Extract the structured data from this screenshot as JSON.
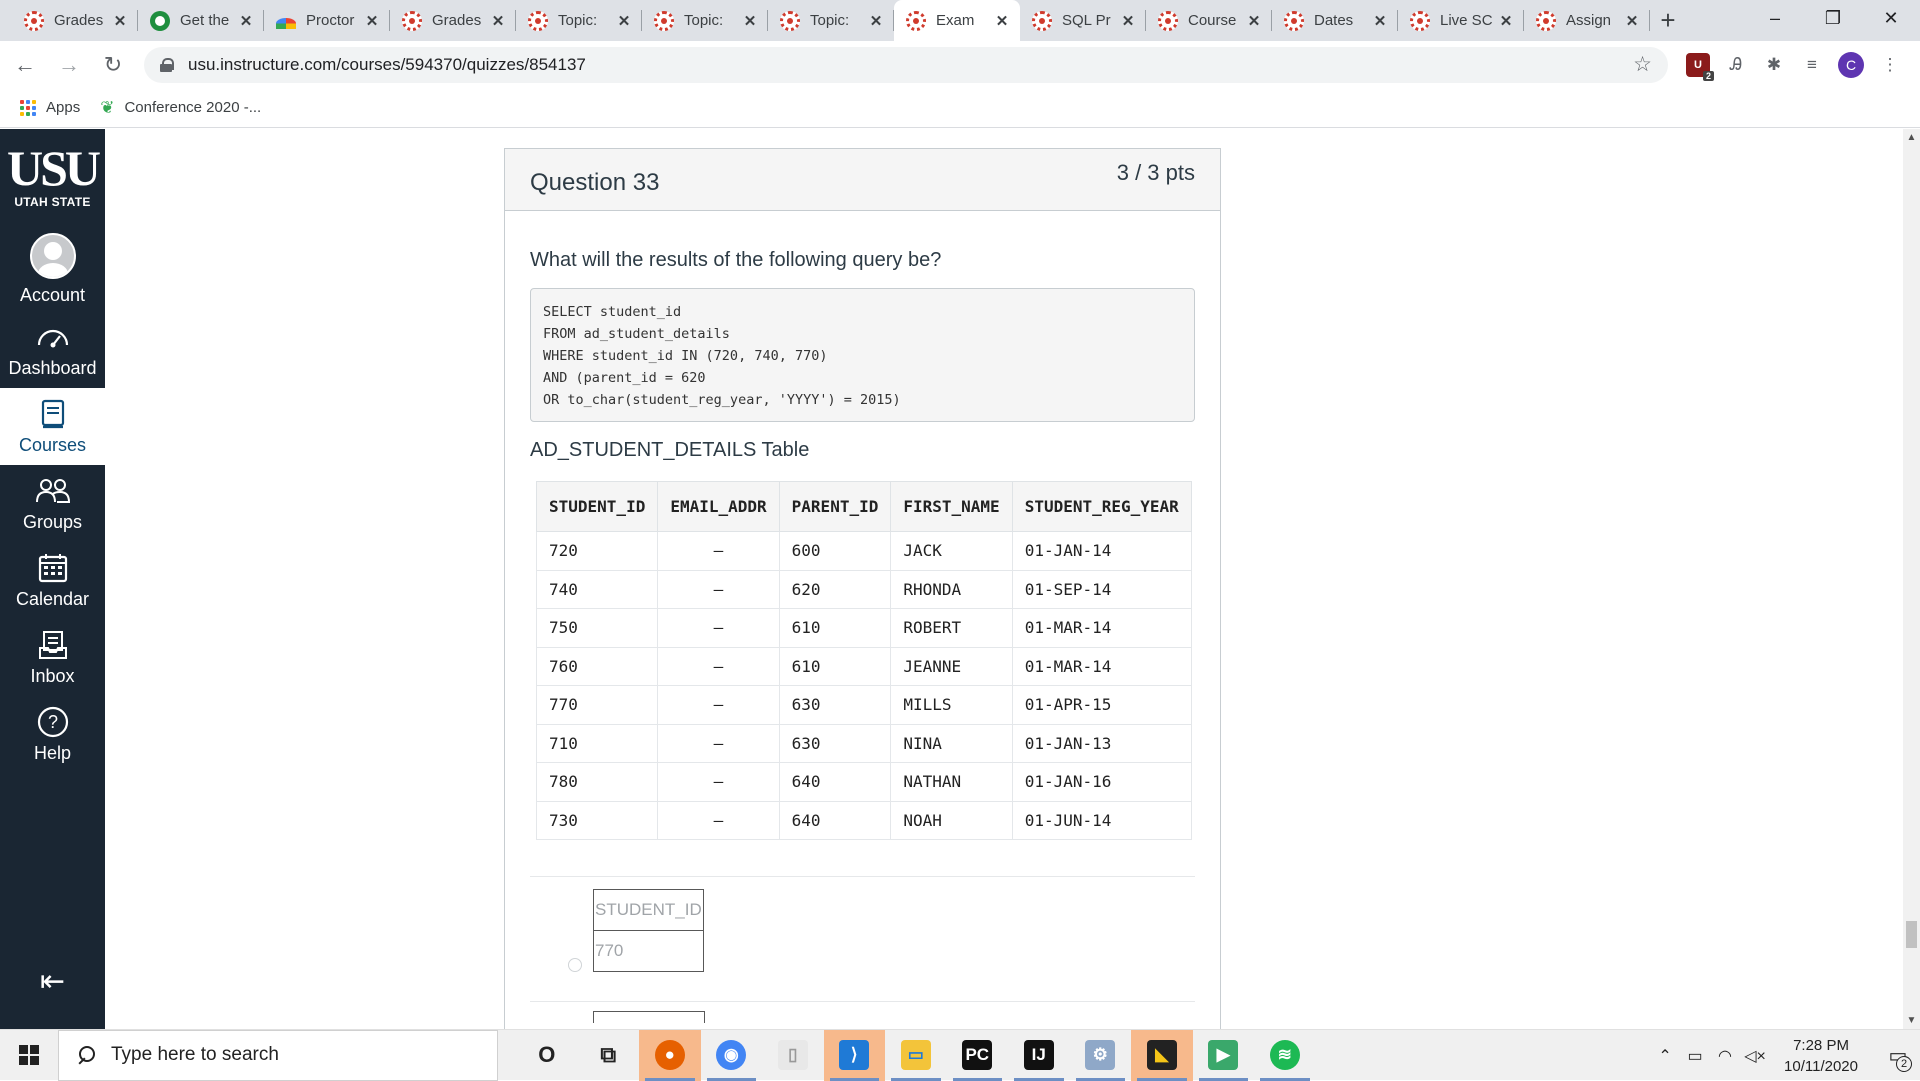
{
  "browser": {
    "tabs": [
      {
        "title": "Grades",
        "favicon": "canvas-icon"
      },
      {
        "title": "Get the",
        "favicon": "green-circle-icon"
      },
      {
        "title": "Proctor",
        "favicon": "rainbow-icon"
      },
      {
        "title": "Grades",
        "favicon": "canvas-icon"
      },
      {
        "title": "Topic: ",
        "favicon": "canvas-icon"
      },
      {
        "title": "Topic: ",
        "favicon": "canvas-icon"
      },
      {
        "title": "Topic: ",
        "favicon": "canvas-icon"
      },
      {
        "title": "Exam ",
        "favicon": "canvas-icon",
        "active": true
      },
      {
        "title": "SQL Pr",
        "favicon": "canvas-icon"
      },
      {
        "title": "Course",
        "favicon": "canvas-icon"
      },
      {
        "title": "Dates ",
        "favicon": "canvas-icon"
      },
      {
        "title": "Live SC",
        "favicon": "canvas-icon"
      },
      {
        "title": "Assign",
        "favicon": "canvas-icon"
      }
    ],
    "url": "usu.instructure.com/courses/594370/quizzes/854137",
    "profile_initial": "C",
    "extension_badge": "2",
    "bookmarks": {
      "apps_label": "Apps",
      "conference_label": "Conference 2020 -..."
    }
  },
  "global_nav": {
    "logo_text": "USU",
    "logo_sub": "UTAH STATE",
    "items": [
      {
        "label": "Account",
        "icon": "account-avatar-icon"
      },
      {
        "label": "Dashboard",
        "icon": "dashboard-icon"
      },
      {
        "label": "Courses",
        "icon": "courses-icon",
        "active": true
      },
      {
        "label": "Groups",
        "icon": "groups-icon"
      },
      {
        "label": "Calendar",
        "icon": "calendar-icon"
      },
      {
        "label": "Inbox",
        "icon": "inbox-icon"
      },
      {
        "label": "Help",
        "icon": "help-icon"
      }
    ]
  },
  "question": {
    "title": "Question 33",
    "points": "3 / 3 pts",
    "text": "What will the results of the following query be?",
    "code": "SELECT student_id\nFROM ad_student_details\nWHERE student_id IN (720, 740, 770)\nAND (parent_id = 620\nOR to_char(student_reg_year, 'YYYY') = 2015)",
    "table_title": "AD_STUDENT_DETAILS Table",
    "table": {
      "headers": [
        "STUDENT_ID",
        "EMAIL_ADDR",
        "PARENT_ID",
        "FIRST_NAME",
        "STUDENT_REG_YEAR"
      ],
      "rows": [
        [
          "720",
          "–",
          "600",
          "JACK",
          "01-JAN-14"
        ],
        [
          "740",
          "–",
          "620",
          "RHONDA",
          "01-SEP-14"
        ],
        [
          "750",
          "–",
          "610",
          "ROBERT",
          "01-MAR-14"
        ],
        [
          "760",
          "–",
          "610",
          "JEANNE",
          "01-MAR-14"
        ],
        [
          "770",
          "–",
          "630",
          "MILLS",
          "01-APR-15"
        ],
        [
          "710",
          "–",
          "630",
          "NINA",
          "01-JAN-13"
        ],
        [
          "780",
          "–",
          "640",
          "NATHAN",
          "01-JAN-16"
        ],
        [
          "730",
          "–",
          "640",
          "NOAH",
          "01-JUN-14"
        ]
      ]
    },
    "answer_option": {
      "header": "STUDENT_ID",
      "value": "770"
    }
  },
  "taskbar": {
    "search_placeholder": "Type here to search",
    "time": "7:28 PM",
    "date": "10/11/2020",
    "notification_count": "2",
    "apps": [
      {
        "name": "cortana-icon",
        "glyph": "O"
      },
      {
        "name": "task-view-icon",
        "glyph": "⧉"
      },
      {
        "name": "firefox-icon",
        "glyph": "●"
      },
      {
        "name": "chrome-icon",
        "glyph": "◉"
      },
      {
        "name": "file-icon",
        "glyph": "▯"
      },
      {
        "name": "vscode-icon",
        "glyph": "⟩"
      },
      {
        "name": "file-explorer-icon",
        "glyph": "▭"
      },
      {
        "name": "pycharm-icon",
        "glyph": "PC"
      },
      {
        "name": "intellij-icon",
        "glyph": "IJ"
      },
      {
        "name": "installer-icon",
        "glyph": "⚙"
      },
      {
        "name": "sticky-notes-icon",
        "glyph": "◣"
      },
      {
        "name": "media-app-icon",
        "glyph": "▶"
      },
      {
        "name": "spotify-icon",
        "glyph": "≋"
      }
    ]
  },
  "colors": {
    "canvas_nav": "#1a2633",
    "canvas_red": "#d03b2d",
    "active_nav_text": "#0e4d79"
  }
}
